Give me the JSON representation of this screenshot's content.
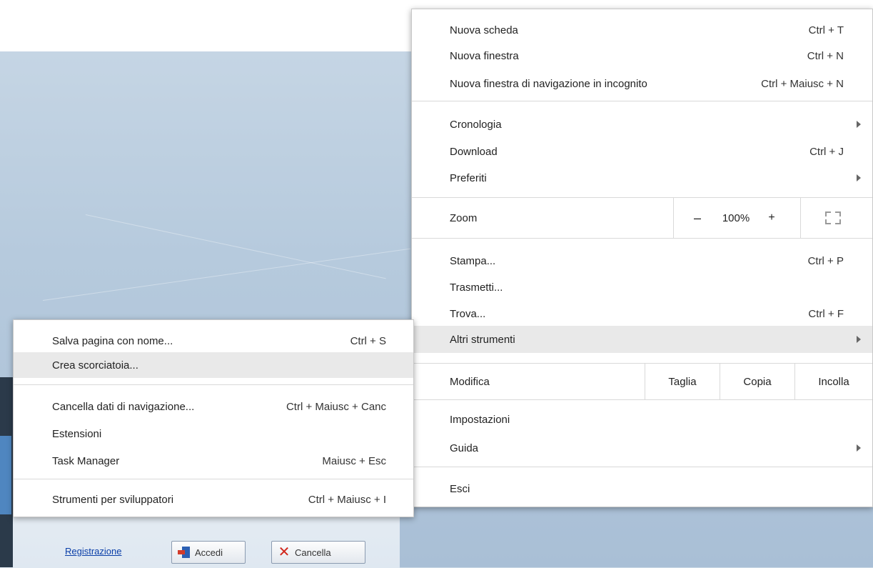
{
  "main_menu": {
    "new_tab": {
      "label": "Nuova scheda",
      "shortcut": "Ctrl + T"
    },
    "new_window": {
      "label": "Nuova finestra",
      "shortcut": "Ctrl + N"
    },
    "incognito": {
      "label": "Nuova finestra di navigazione in incognito",
      "shortcut": "Ctrl + Maiusc + N"
    },
    "history": {
      "label": "Cronologia"
    },
    "downloads": {
      "label": "Download",
      "shortcut": "Ctrl + J"
    },
    "bookmarks": {
      "label": "Preferiti"
    },
    "zoom": {
      "label": "Zoom",
      "minus": "–",
      "value": "100%",
      "plus": "+"
    },
    "print": {
      "label": "Stampa...",
      "shortcut": "Ctrl + P"
    },
    "cast": {
      "label": "Trasmetti..."
    },
    "find": {
      "label": "Trova...",
      "shortcut": "Ctrl + F"
    },
    "more_tools": {
      "label": "Altri strumenti"
    },
    "edit": {
      "label": "Modifica",
      "cut": "Taglia",
      "copy": "Copia",
      "paste": "Incolla"
    },
    "settings": {
      "label": "Impostazioni"
    },
    "help": {
      "label": "Guida"
    },
    "exit": {
      "label": "Esci"
    }
  },
  "sub_menu": {
    "save_page": {
      "label": "Salva pagina con nome...",
      "shortcut": "Ctrl + S"
    },
    "create_shortcut": {
      "label": "Crea scorciatoia..."
    },
    "clear_data": {
      "label": "Cancella dati di navigazione...",
      "shortcut": "Ctrl + Maiusc + Canc"
    },
    "extensions": {
      "label": "Estensioni"
    },
    "task_manager": {
      "label": "Task Manager",
      "shortcut": "Maiusc + Esc"
    },
    "dev_tools": {
      "label": "Strumenti per sviluppatori",
      "shortcut": "Ctrl + Maiusc + I"
    }
  },
  "background_app": {
    "register_link": "Registrazione",
    "login_button": "Accedi",
    "cancel_button": "Cancella"
  },
  "icons": {
    "submenu_arrow": "chevron-right-icon",
    "fullscreen": "fullscreen-icon",
    "login": "door-enter-icon",
    "cancel": "red-x-icon"
  }
}
